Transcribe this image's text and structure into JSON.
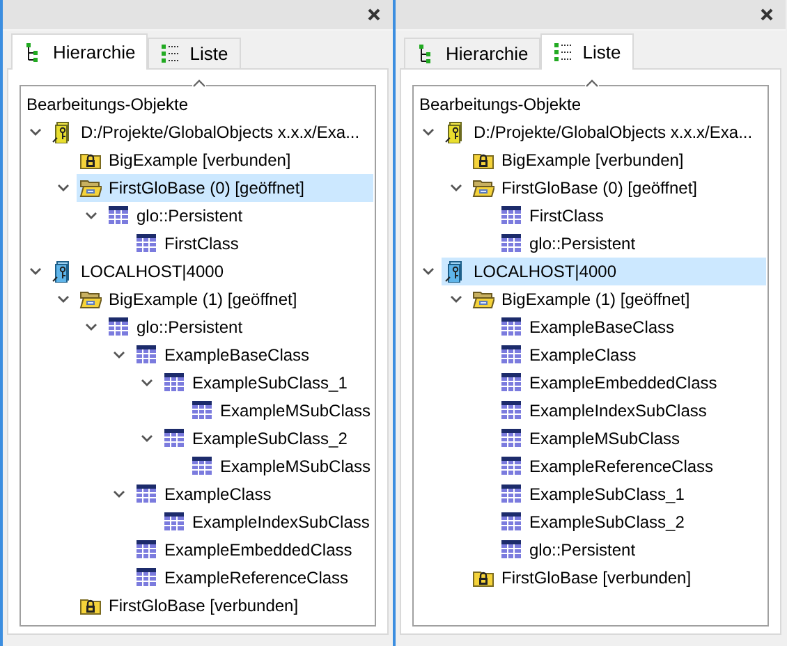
{
  "panels": [
    {
      "tabs": [
        {
          "label": "Hierarchie",
          "kind": "hierarchy",
          "selected": true
        },
        {
          "label": "Liste",
          "kind": "list",
          "selected": false
        }
      ],
      "tree": {
        "heading": "Bearbeitungs-Objekte",
        "nodes": [
          {
            "label": "D:/Projekte/GlobalObjects x.x.x/Exa...",
            "kind": "project",
            "expanded": true,
            "selected": false,
            "children": [
              {
                "label": "BigExample [verbunden]",
                "kind": "locked-db",
                "selected": false
              },
              {
                "label": "FirstGloBase (0) [geöffnet]",
                "kind": "open-db",
                "expanded": true,
                "selected": true,
                "children": [
                  {
                    "label": "glo::Persistent",
                    "kind": "class",
                    "expanded": true,
                    "selected": false,
                    "children": [
                      {
                        "label": "FirstClass",
                        "kind": "class",
                        "selected": false
                      }
                    ]
                  }
                ]
              }
            ]
          },
          {
            "label": "LOCALHOST|4000",
            "kind": "server",
            "expanded": true,
            "selected": false,
            "children": [
              {
                "label": "BigExample (1) [geöffnet]",
                "kind": "open-db",
                "expanded": true,
                "selected": false,
                "children": [
                  {
                    "label": "glo::Persistent",
                    "kind": "class",
                    "expanded": true,
                    "selected": false,
                    "children": [
                      {
                        "label": "ExampleBaseClass",
                        "kind": "class",
                        "expanded": true,
                        "selected": false,
                        "children": [
                          {
                            "label": "ExampleSubClass_1",
                            "kind": "class",
                            "expanded": true,
                            "selected": false,
                            "children": [
                              {
                                "label": "ExampleMSubClass",
                                "kind": "class",
                                "selected": false
                              }
                            ]
                          },
                          {
                            "label": "ExampleSubClass_2",
                            "kind": "class",
                            "expanded": true,
                            "selected": false,
                            "children": [
                              {
                                "label": "ExampleMSubClass",
                                "kind": "class",
                                "selected": false
                              }
                            ]
                          }
                        ]
                      },
                      {
                        "label": "ExampleClass",
                        "kind": "class",
                        "expanded": true,
                        "selected": false,
                        "children": [
                          {
                            "label": "ExampleIndexSubClass",
                            "kind": "class",
                            "selected": false
                          }
                        ]
                      },
                      {
                        "label": "ExampleEmbeddedClass",
                        "kind": "class",
                        "selected": false
                      },
                      {
                        "label": "ExampleReferenceClass",
                        "kind": "class",
                        "selected": false
                      }
                    ]
                  }
                ]
              },
              {
                "label": "FirstGloBase [verbunden]",
                "kind": "locked-db",
                "selected": false
              }
            ]
          }
        ]
      }
    },
    {
      "tabs": [
        {
          "label": "Hierarchie",
          "kind": "hierarchy",
          "selected": false
        },
        {
          "label": "Liste",
          "kind": "list",
          "selected": true
        }
      ],
      "tree": {
        "heading": "Bearbeitungs-Objekte",
        "nodes": [
          {
            "label": "D:/Projekte/GlobalObjects x.x.x/Exa...",
            "kind": "project",
            "expanded": true,
            "selected": false,
            "children": [
              {
                "label": "BigExample [verbunden]",
                "kind": "locked-db",
                "selected": false
              },
              {
                "label": "FirstGloBase (0) [geöffnet]",
                "kind": "open-db",
                "expanded": true,
                "selected": false,
                "children": [
                  {
                    "label": "FirstClass",
                    "kind": "class",
                    "selected": false
                  },
                  {
                    "label": "glo::Persistent",
                    "kind": "class",
                    "selected": false
                  }
                ]
              }
            ]
          },
          {
            "label": "LOCALHOST|4000",
            "kind": "server",
            "expanded": true,
            "selected": true,
            "children": [
              {
                "label": "BigExample (1) [geöffnet]",
                "kind": "open-db",
                "expanded": true,
                "selected": false,
                "children": [
                  {
                    "label": "ExampleBaseClass",
                    "kind": "class",
                    "selected": false
                  },
                  {
                    "label": "ExampleClass",
                    "kind": "class",
                    "selected": false
                  },
                  {
                    "label": "ExampleEmbeddedClass",
                    "kind": "class",
                    "selected": false
                  },
                  {
                    "label": "ExampleIndexSubClass",
                    "kind": "class",
                    "selected": false
                  },
                  {
                    "label": "ExampleMSubClass",
                    "kind": "class",
                    "selected": false
                  },
                  {
                    "label": "ExampleReferenceClass",
                    "kind": "class",
                    "selected": false
                  },
                  {
                    "label": "ExampleSubClass_1",
                    "kind": "class",
                    "selected": false
                  },
                  {
                    "label": "ExampleSubClass_2",
                    "kind": "class",
                    "selected": false
                  },
                  {
                    "label": "glo::Persistent",
                    "kind": "class",
                    "selected": false
                  }
                ]
              },
              {
                "label": "FirstGloBase [verbunden]",
                "kind": "locked-db",
                "selected": false
              }
            ]
          }
        ]
      }
    }
  ]
}
